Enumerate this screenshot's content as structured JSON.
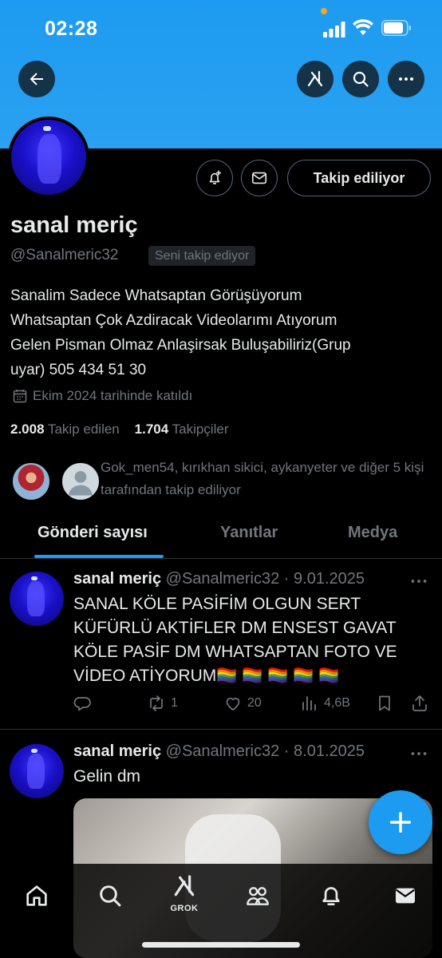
{
  "status_bar": {
    "time": "02:28"
  },
  "profile": {
    "display_name": "sanal meriç",
    "handle": "@Sanalmeric32",
    "follows_you_badge": "Seni takip ediyor",
    "follow_button_label": "Takip ediliyor",
    "bio": "Sanalim Sadece Whatsaptan Görüşüyorum\nWhatsaptan Çok Azdiracak Videolarımı Atıyorum\nGelen Pisman Olmaz Anlaşirsak Buluşabiliriz(Grup\nuyar) 505 434 51 30",
    "joined": "Ekim 2024 tarihinde katıldı",
    "following_count": "2.008",
    "following_label": "Takip edilen",
    "followers_count": "1.704",
    "followers_label": "Takipçiler",
    "followers_you_know": "Gok_men54, kırıkhan sikici, aykanyeter ve diğer 5 kişi tarafından takip ediliyor"
  },
  "tabs": [
    {
      "label": "Gönderi sayısı",
      "active": true
    },
    {
      "label": "Yanıtlar",
      "active": false
    },
    {
      "label": "Medya",
      "active": false
    }
  ],
  "posts": [
    {
      "name": "sanal meriç",
      "handle": "@Sanalmeric32",
      "date": "· 9.01.2025",
      "text": "SANAL KÖLE PASİFİM  OLGUN SERT KÜFÜRLÜ AKTİFLER DM ENSEST GAVAT KÖLE PASİF DM WHATSAPTAN FOTO VE VİDEO ATİYORUM🏳️‍🌈 🏳️‍🌈 🏳️‍🌈 🏳️‍🌈 🏳️‍🌈",
      "reposts": "1",
      "likes": "20",
      "views": "4,6B"
    },
    {
      "name": "sanal meriç",
      "handle": "@Sanalmeric32",
      "date": "· 8.01.2025",
      "text": "Gelin dm"
    }
  ],
  "bottom_nav": {
    "grok_label": "GROK"
  },
  "icons": {
    "back": "back-arrow-icon",
    "grok": "grok-icon",
    "search": "search-icon",
    "more": "more-icon",
    "notify": "bell-plus-icon",
    "message": "envelope-icon",
    "calendar": "calendar-icon",
    "reply": "reply-icon",
    "repost": "repost-icon",
    "like": "heart-icon",
    "views": "views-icon",
    "bookmark": "bookmark-icon",
    "share": "share-icon",
    "compose": "plus-icon",
    "home": "home-icon",
    "communities": "communities-icon",
    "notifications": "bell-icon",
    "messages": "mail-icon"
  },
  "colors": {
    "accent": "#1d9bf0",
    "background": "#000000",
    "muted": "#71767b",
    "text": "#e7e9ea"
  }
}
